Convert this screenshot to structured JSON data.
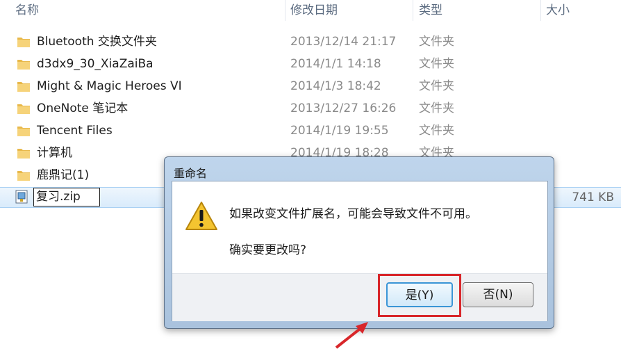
{
  "columns": {
    "name": "名称",
    "date": "修改日期",
    "type": "类型",
    "size": "大小"
  },
  "files": [
    {
      "name": "Bluetooth 交换文件夹",
      "date": "2013/12/14 21:17",
      "type": "文件夹"
    },
    {
      "name": "d3dx9_30_XiaZaiBa",
      "date": "2014/1/1 14:18",
      "type": "文件夹"
    },
    {
      "name": "Might & Magic Heroes VI",
      "date": "2014/1/3 18:42",
      "type": "文件夹"
    },
    {
      "name": "OneNote 笔记本",
      "date": "2013/12/27 16:26",
      "type": "文件夹"
    },
    {
      "name": "Tencent Files",
      "date": "2014/1/19 19:55",
      "type": "文件夹"
    },
    {
      "name": "计算机",
      "date": "2014/1/19 18:28",
      "type": "文件夹"
    },
    {
      "name": "鹿鼎记(1)",
      "date": "",
      "type": ""
    }
  ],
  "selected_file": {
    "name": "复习.zip",
    "size": "741 KB"
  },
  "dialog": {
    "title": "重命名",
    "message": "如果改变文件扩展名，可能会导致文件不可用。",
    "question": "确实要更改吗?",
    "yes_label": "是(Y)",
    "no_label": "否(N)"
  },
  "colors": {
    "folder": "#e8b84a",
    "highlight": "#d8262a",
    "selection": "#d9ebfb"
  },
  "icons": {
    "folder": "folder-icon",
    "zip": "zip-file-icon",
    "warning": "warning-icon",
    "arrow": "red-arrow-annotation"
  }
}
